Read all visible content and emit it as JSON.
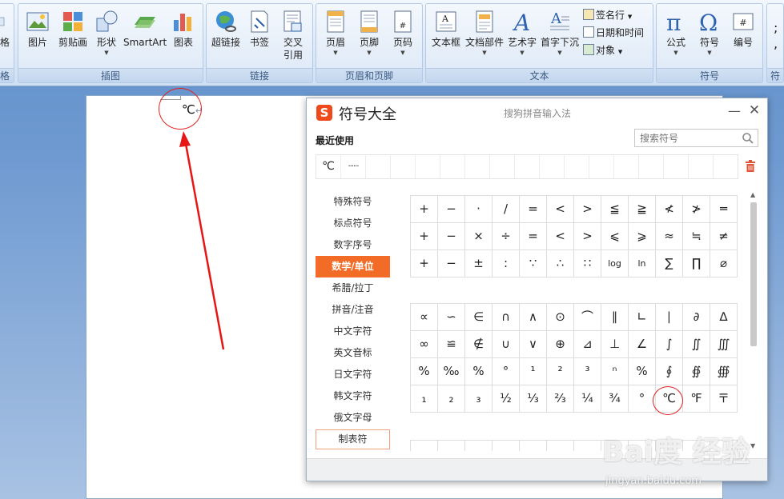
{
  "ribbon": {
    "groups": {
      "illustrations": "插图",
      "links": "链接",
      "header_footer": "页眉和页脚",
      "text": "文本",
      "symbols": "符号",
      "left_partial": "格",
      "right_partial": "符"
    },
    "buttons": {
      "picture": "图片",
      "clipart": "剪贴画",
      "shapes": "形状",
      "smartart": "SmartArt",
      "chart": "图表",
      "hyperlink": "超链接",
      "bookmark": "书签",
      "crossref_line1": "交叉",
      "crossref_line2": "引用",
      "header": "页眉",
      "footer": "页脚",
      "page_number": "页码",
      "textbox": "文本框",
      "quick_parts": "文档部件",
      "wordart": "艺术字",
      "drop_cap": "首字下沉",
      "signature_line": "签名行",
      "date_time": "日期和时间",
      "object": "对象",
      "equation": "公式",
      "symbol": "符号",
      "numbering": "编号",
      "left_partial": "格"
    }
  },
  "document": {
    "text": "℃",
    "paragraph_mark": "↵"
  },
  "symbol_window": {
    "logo": "S",
    "title": "符号大全",
    "subtitle": "搜狗拼音输入法",
    "minimize": "—",
    "close": "✕",
    "recent_label": "最近使用",
    "search_placeholder": "搜索符号",
    "recent": [
      "℃",
      "······"
    ],
    "categories": [
      "特殊符号",
      "标点符号",
      "数字序号",
      "数学/单位",
      "希腊/拉丁",
      "拼音/注音",
      "中文字符",
      "英文音标",
      "日文字符",
      "韩文字符",
      "俄文字母",
      "制表符"
    ],
    "active_category": "数学/单位",
    "grid1": [
      "+",
      "−",
      "·",
      "/",
      "=",
      "<",
      ">",
      "≦",
      "≧",
      "≮",
      "≯",
      "═",
      "+",
      "−",
      "×",
      "÷",
      "=",
      "<",
      ">",
      "⩽",
      "⩾",
      "≈",
      "≒",
      "≠",
      "+",
      "−",
      "±",
      ":",
      "∵",
      "∴",
      "∷",
      "log",
      "ln",
      "∑",
      "∏",
      "⌀"
    ],
    "grid2": [
      "∝",
      "∽",
      "∈",
      "∩",
      "∧",
      "⊙",
      "⌒",
      "∥",
      "∟",
      "∣",
      "∂",
      "∆",
      "∞",
      "≌",
      "∉",
      "∪",
      "∨",
      "⊕",
      "⊿",
      "⊥",
      "∠",
      "∫",
      "∬",
      "∭",
      "%",
      "‰",
      "%",
      "°",
      "¹",
      "²",
      "³",
      "ⁿ",
      "%",
      "∮",
      "∯",
      "∰",
      "₁",
      "₂",
      "₃",
      "½",
      "⅓",
      "⅔",
      "¼",
      "¾",
      "°",
      "℃",
      "℉",
      "〒"
    ]
  },
  "watermark": {
    "text": "Bai度 经验",
    "url": "jingyan.baidu.com"
  }
}
